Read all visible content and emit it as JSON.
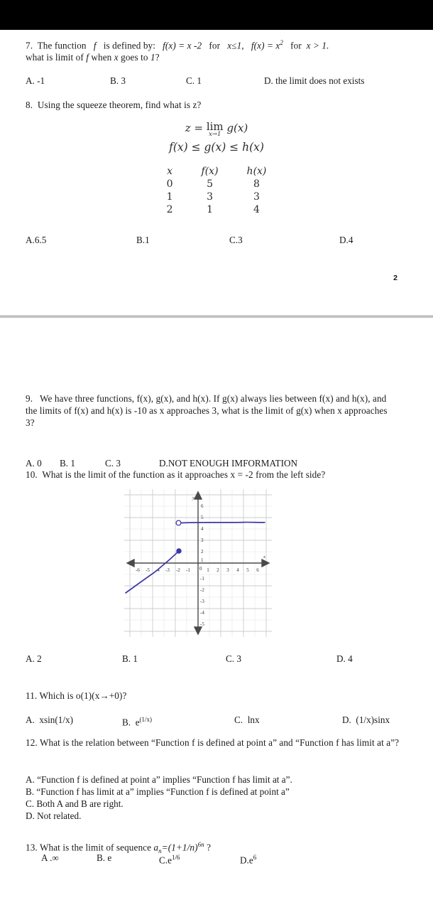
{
  "document": {
    "page_number": "2",
    "top_bar_color": "#000000",
    "divider_color": "#c0c0c0",
    "ink_color": "#3333aa"
  },
  "questions": [
    {
      "number": "7.",
      "prompt_line1_a": "The function",
      "prompt_line1_f": "f",
      "prompt_line1_b": "is defined by:",
      "def1": "f(x) = x -2",
      "for1": "for",
      "cond1": "x≤1,",
      "def2": "f(x) = x",
      "def2sup": "2",
      "for2": "for",
      "cond2": "x > 1.",
      "prompt_line2_a": "what is limit of",
      "prompt_line2_f": "f",
      "prompt_line2_b": "when",
      "prompt_line2_x": "x",
      "prompt_line2_c": "goes to",
      "prompt_line2_one": "1",
      "prompt_line2_q": "?",
      "options": [
        "A. -1",
        "B. 3",
        "C. 1",
        "D. the limit does not exists"
      ]
    },
    {
      "number": "8.",
      "prompt": "Using the squeeze theorem, find what is z?",
      "formula": {
        "z": "z",
        "equals": "=",
        "lim": "lim",
        "lim_sub": "x→1",
        "gx": "g(x)",
        "inequality": "f(x) ≤ g(x) ≤ h(x)"
      },
      "table": {
        "headers": [
          "x",
          "f(x)",
          "h(x)"
        ],
        "rows": [
          [
            "0",
            "5",
            "8"
          ],
          [
            "1",
            "3",
            "3"
          ],
          [
            "2",
            "1",
            "4"
          ]
        ]
      },
      "options": [
        "A.6.5",
        "B.1",
        "C.3",
        "D.4"
      ]
    },
    {
      "number": "9.",
      "prompt": "We have three functions, f(x), g(x), and h(x). If g(x) always lies between f(x) and h(x), and the limits of f(x) and h(x) is -10 as x approaches 3, what is the limit of g(x) when x approaches 3?",
      "options": [
        "A. 0",
        "B. 1",
        "C. 3",
        "D.NOT ENOUGH IMFORMATION"
      ]
    },
    {
      "number": "10.",
      "prompt": "What is the limit of the function as it approaches x = -2 from the left side?",
      "options": [
        "A. 2",
        "B. 1",
        "C. 3",
        "D. 4"
      ]
    },
    {
      "number": "11.",
      "prompt": "Which is o(1)(x→+0)?",
      "options_rich": [
        {
          "label": "A.",
          "expr": "xsin(1/x)",
          "sup": ""
        },
        {
          "label": "B.",
          "expr": "e",
          "sup": "(1/x)"
        },
        {
          "label": "C.",
          "expr": "lnx",
          "sup": ""
        },
        {
          "label": "D.",
          "expr": "(1/x)sinx",
          "sup": ""
        }
      ]
    },
    {
      "number": "12.",
      "prompt": "What is the relation between “Function f is defined at point a” and “Function f has limit at a”?",
      "options": [
        "A. “Function f is defined at point a” implies “Function f has limit at a”.",
        "B. “Function f has limit at a” implies “Function f is defined at point a”",
        "C. Both A and B are right.",
        "D. Not related."
      ]
    },
    {
      "number": "13.",
      "prompt_a": "What is the limit of sequence",
      "prompt_var": "a",
      "prompt_varsub": "n",
      "prompt_expr": "=(1+1/n)",
      "prompt_expr_sup": "6n",
      "prompt_q": "?",
      "options_rich": [
        {
          "label": "A .",
          "expr": "∞",
          "sup": ""
        },
        {
          "label": "B.",
          "expr": "e",
          "sup": ""
        },
        {
          "label": "C.",
          "expr": "e",
          "sup": "1/6"
        },
        {
          "label": "D.",
          "expr": "e",
          "sup": "6"
        }
      ]
    }
  ],
  "graph": {
    "x_ticks": [
      "-6",
      "-5",
      "-4",
      "-3",
      "-2",
      "-1",
      "1",
      "2",
      "3",
      "4",
      "5",
      "6"
    ],
    "y_ticks": [
      "6",
      "5",
      "4",
      "3",
      "2",
      "1",
      "-1",
      "-2",
      "-3",
      "-4",
      "-5"
    ],
    "origin_label": "0",
    "x_axis_label": "x",
    "y_axis_label": "y",
    "curve_color": "#3b37a8",
    "grid_color": "#d9d9d9",
    "open_circle_at": "(-1.8, 3.6)",
    "filled_dot_at": "(-1.7, 1.5)",
    "horizontal_branch_y": "3.6",
    "ramp_from": "(-6.5, -2.5)",
    "ramp_to": "(-1.7, 1.5)"
  }
}
